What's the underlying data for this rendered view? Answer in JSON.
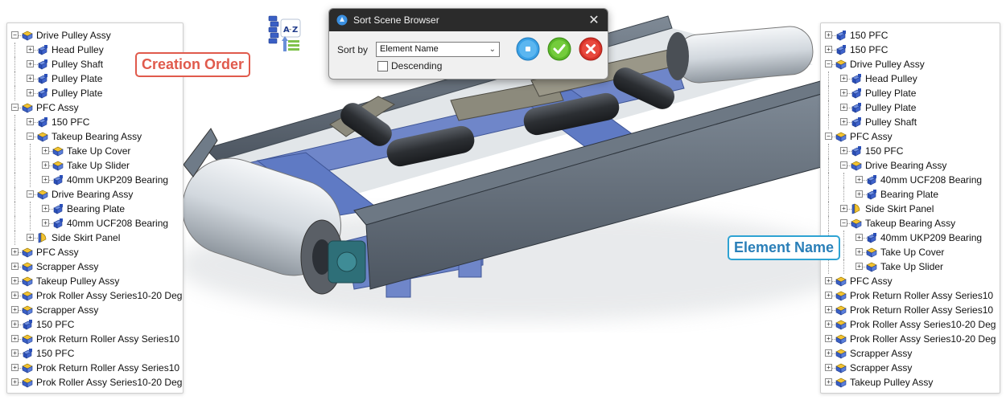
{
  "dialog": {
    "title": "Sort Scene Browser",
    "sort_by_label": "Sort by",
    "sort_by_value": "Element Name",
    "descending_label": "Descending",
    "descending_checked": false,
    "close_icon": "close-icon",
    "buttons": [
      "preview-button",
      "ok-button",
      "cancel-button"
    ]
  },
  "callouts": {
    "creation_order": "Creation Order",
    "element_name": "Element Name"
  },
  "colors": {
    "creation_callout": "#e05a4c",
    "element_callout": "#2ea3d3",
    "ok_button": "#5cb82a",
    "cancel_button": "#d9332a",
    "preview_button": "#3aa1e6"
  },
  "left_tree": [
    {
      "label": "Drive Pulley Assy",
      "level": 0,
      "icon": "assembly-icon",
      "expanded": true
    },
    {
      "label": "Head Pulley",
      "level": 1,
      "icon": "part-icon",
      "expanded": false
    },
    {
      "label": "Pulley Shaft",
      "level": 1,
      "icon": "part-icon",
      "expanded": false
    },
    {
      "label": "Pulley Plate",
      "level": 1,
      "icon": "part-icon",
      "expanded": false
    },
    {
      "label": "Pulley Plate",
      "level": 1,
      "icon": "part-icon",
      "expanded": false
    },
    {
      "label": "PFC Assy",
      "level": 0,
      "icon": "assembly-icon",
      "expanded": true
    },
    {
      "label": "150 PFC",
      "level": 1,
      "icon": "part-icon",
      "expanded": false
    },
    {
      "label": "Takeup Bearing Assy",
      "level": 1,
      "icon": "assembly-icon",
      "expanded": true
    },
    {
      "label": "Take Up Cover",
      "level": 2,
      "icon": "assembly-icon",
      "expanded": false
    },
    {
      "label": "Take Up Slider",
      "level": 2,
      "icon": "assembly-icon",
      "expanded": false
    },
    {
      "label": "40mm UKP209 Bearing",
      "level": 2,
      "icon": "part-icon",
      "expanded": false
    },
    {
      "label": "Drive Bearing Assy",
      "level": 1,
      "icon": "assembly-icon",
      "expanded": true
    },
    {
      "label": "Bearing Plate",
      "level": 2,
      "icon": "part-icon",
      "expanded": false
    },
    {
      "label": "40mm UCF208 Bearing",
      "level": 2,
      "icon": "part-icon",
      "expanded": false
    },
    {
      "label": "Side Skirt Panel",
      "level": 1,
      "icon": "panel-icon",
      "expanded": false
    },
    {
      "label": "PFC Assy",
      "level": 0,
      "icon": "assembly-icon",
      "expanded": false
    },
    {
      "label": "Scrapper Assy",
      "level": 0,
      "icon": "assembly-icon",
      "expanded": false
    },
    {
      "label": "Takeup Pulley Assy",
      "level": 0,
      "icon": "assembly-icon",
      "expanded": false
    },
    {
      "label": "Prok Roller Assy Series10-20 Deg",
      "level": 0,
      "icon": "assembly-icon",
      "expanded": false
    },
    {
      "label": "Scrapper Assy",
      "level": 0,
      "icon": "assembly-icon",
      "expanded": false
    },
    {
      "label": "150 PFC",
      "level": 0,
      "icon": "part-icon",
      "expanded": false
    },
    {
      "label": "Prok Return Roller Assy Series10",
      "level": 0,
      "icon": "assembly-icon",
      "expanded": false
    },
    {
      "label": "150 PFC",
      "level": 0,
      "icon": "part-icon",
      "expanded": false
    },
    {
      "label": "Prok Return Roller Assy Series10",
      "level": 0,
      "icon": "assembly-icon",
      "expanded": false
    },
    {
      "label": "Prok Roller Assy Series10-20 Deg",
      "level": 0,
      "icon": "assembly-icon",
      "expanded": false
    }
  ],
  "right_tree": [
    {
      "label": "150 PFC",
      "level": 0,
      "icon": "part-icon",
      "expanded": false
    },
    {
      "label": "150 PFC",
      "level": 0,
      "icon": "part-icon",
      "expanded": false
    },
    {
      "label": "Drive Pulley Assy",
      "level": 0,
      "icon": "assembly-icon",
      "expanded": true
    },
    {
      "label": "Head Pulley",
      "level": 1,
      "icon": "part-icon",
      "expanded": false
    },
    {
      "label": "Pulley Plate",
      "level": 1,
      "icon": "part-icon",
      "expanded": false
    },
    {
      "label": "Pulley Plate",
      "level": 1,
      "icon": "part-icon",
      "expanded": false
    },
    {
      "label": "Pulley Shaft",
      "level": 1,
      "icon": "part-icon",
      "expanded": false
    },
    {
      "label": "PFC Assy",
      "level": 0,
      "icon": "assembly-icon",
      "expanded": true
    },
    {
      "label": "150 PFC",
      "level": 1,
      "icon": "part-icon",
      "expanded": false
    },
    {
      "label": "Drive Bearing Assy",
      "level": 1,
      "icon": "assembly-icon",
      "expanded": true
    },
    {
      "label": "40mm UCF208 Bearing",
      "level": 2,
      "icon": "part-icon",
      "expanded": false
    },
    {
      "label": "Bearing Plate",
      "level": 2,
      "icon": "part-icon",
      "expanded": false
    },
    {
      "label": "Side Skirt Panel",
      "level": 1,
      "icon": "panel-icon",
      "expanded": false
    },
    {
      "label": "Takeup Bearing Assy",
      "level": 1,
      "icon": "assembly-icon",
      "expanded": true
    },
    {
      "label": "40mm UKP209 Bearing",
      "level": 2,
      "icon": "part-icon",
      "expanded": false
    },
    {
      "label": "Take Up Cover",
      "level": 2,
      "icon": "assembly-icon",
      "expanded": false
    },
    {
      "label": "Take Up Slider",
      "level": 2,
      "icon": "assembly-icon",
      "expanded": false
    },
    {
      "label": "PFC Assy",
      "level": 0,
      "icon": "assembly-icon",
      "expanded": false
    },
    {
      "label": "Prok Return Roller Assy Series10",
      "level": 0,
      "icon": "assembly-icon",
      "expanded": false
    },
    {
      "label": "Prok Return Roller Assy Series10",
      "level": 0,
      "icon": "assembly-icon",
      "expanded": false
    },
    {
      "label": "Prok Roller Assy Series10-20 Deg",
      "level": 0,
      "icon": "assembly-icon",
      "expanded": false
    },
    {
      "label": "Prok Roller Assy Series10-20 Deg",
      "level": 0,
      "icon": "assembly-icon",
      "expanded": false
    },
    {
      "label": "Scrapper Assy",
      "level": 0,
      "icon": "assembly-icon",
      "expanded": false
    },
    {
      "label": "Scrapper Assy",
      "level": 0,
      "icon": "assembly-icon",
      "expanded": false
    },
    {
      "label": "Takeup Pulley Assy",
      "level": 0,
      "icon": "assembly-icon",
      "expanded": false
    }
  ],
  "sort_icon": "sort-az-icon"
}
